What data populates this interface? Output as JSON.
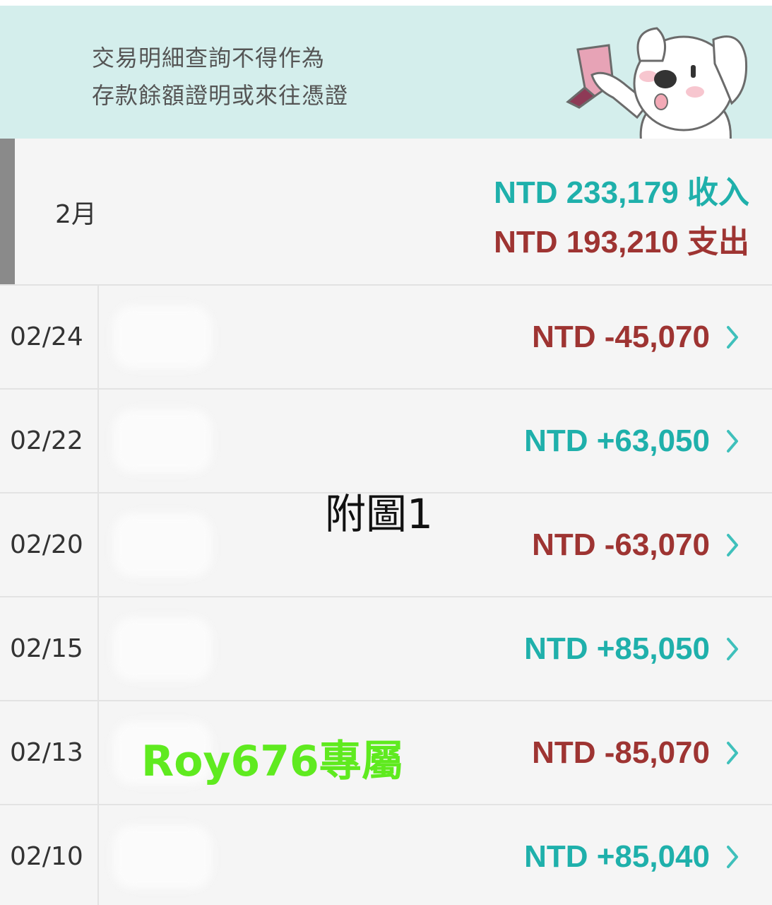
{
  "banner": {
    "line1": "交易明細查詢不得作為",
    "line2": "存款餘額證明或來往憑證",
    "mascot_icon": "dog-holding-receipt-icon"
  },
  "summary": {
    "month": "2月",
    "income": "NTD 233,179 收入",
    "expense": "NTD 193,210 支出"
  },
  "transactions": [
    {
      "date": "02/24",
      "amount": "NTD -45,070",
      "type": "expense"
    },
    {
      "date": "02/22",
      "amount": "NTD +63,050",
      "type": "income"
    },
    {
      "date": "02/20",
      "amount": "NTD -63,070",
      "type": "expense"
    },
    {
      "date": "02/15",
      "amount": "NTD +85,050",
      "type": "income"
    },
    {
      "date": "02/13",
      "amount": "NTD -85,070",
      "type": "expense"
    },
    {
      "date": "02/10",
      "amount": "NTD +85,040",
      "type": "income"
    }
  ],
  "overlay": {
    "figure_label": "附圖1",
    "watermark": "Roy676專屬"
  },
  "colors": {
    "income": "#1fb0ab",
    "expense": "#9e3432",
    "banner_bg": "#d4eeec",
    "watermark": "#5fea1f"
  }
}
